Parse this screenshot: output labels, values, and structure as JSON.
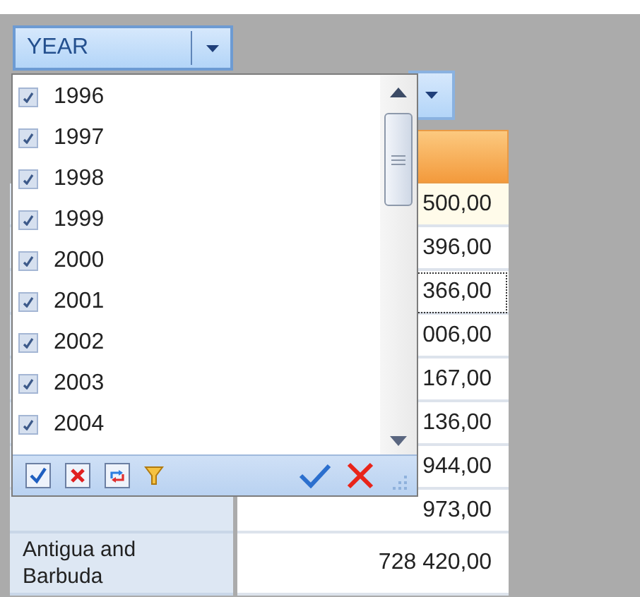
{
  "filter_field": {
    "label": "YEAR"
  },
  "filter_popup": {
    "items": [
      {
        "label": "1996",
        "checked": true
      },
      {
        "label": "1997",
        "checked": true
      },
      {
        "label": "1998",
        "checked": true
      },
      {
        "label": "1999",
        "checked": true
      },
      {
        "label": "2000",
        "checked": true
      },
      {
        "label": "2001",
        "checked": true
      },
      {
        "label": "2002",
        "checked": true
      },
      {
        "label": "2003",
        "checked": true
      },
      {
        "label": "2004",
        "checked": true
      }
    ]
  },
  "grid": {
    "rows": [
      {
        "value": "500,00",
        "highlighted": true,
        "focused": false
      },
      {
        "value": "396,00",
        "highlighted": false,
        "focused": false
      },
      {
        "value": "366,00",
        "highlighted": false,
        "focused": true
      },
      {
        "value": "006,00",
        "highlighted": false,
        "focused": false
      },
      {
        "value": "167,00",
        "highlighted": false,
        "focused": false
      },
      {
        "value": "136,00",
        "highlighted": false,
        "focused": false
      },
      {
        "value": "944,00",
        "highlighted": false,
        "focused": false
      },
      {
        "value": "973,00",
        "highlighted": false,
        "focused": false
      },
      {
        "header": "Antigua and Barbuda",
        "value": "728 420,00",
        "highlighted": false,
        "focused": false
      }
    ]
  }
}
